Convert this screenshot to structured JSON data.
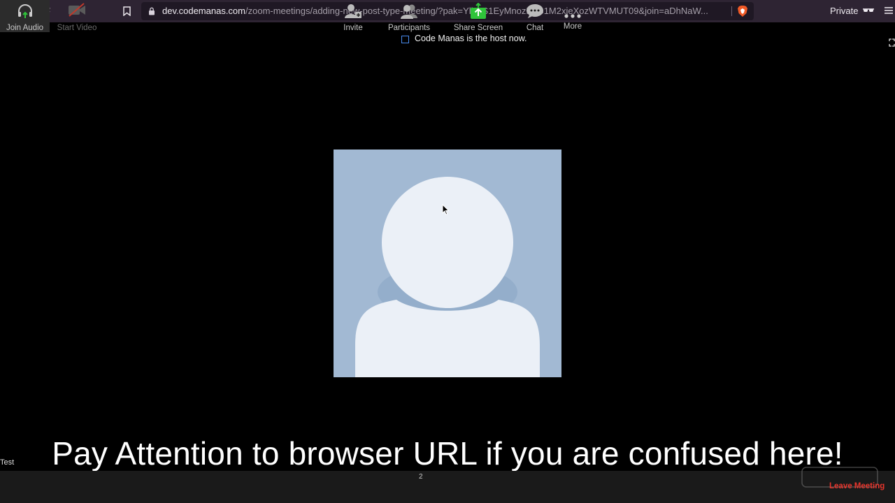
{
  "browser": {
    "url_host": "dev.codemanas.com",
    "url_path": "/zoom-meetings/adding-new-post-type-meeting/?pak=YlhYS1EyMnozR3B1M2xjeXozWTVMUT09&join=aDhNaW...",
    "private_label": "Private"
  },
  "meeting": {
    "notification": "Code Manas is the host now.",
    "participant_name": "Test",
    "caption": "Pay Attention to browser URL if you are confused here!"
  },
  "toolbar": {
    "join_audio": "Join Audio",
    "start_video": "Start Video",
    "invite": "Invite",
    "participants": "Participants",
    "participants_count": "2",
    "share_screen": "Share Screen",
    "chat": "Chat",
    "more": "More",
    "leave_meeting": "Leave Meeting"
  },
  "colors": {
    "share_green": "#2fc43a",
    "leave_red": "#e8352c",
    "avatar_bg": "#a2b9d3",
    "avatar_fg": "#ebf0f7"
  }
}
